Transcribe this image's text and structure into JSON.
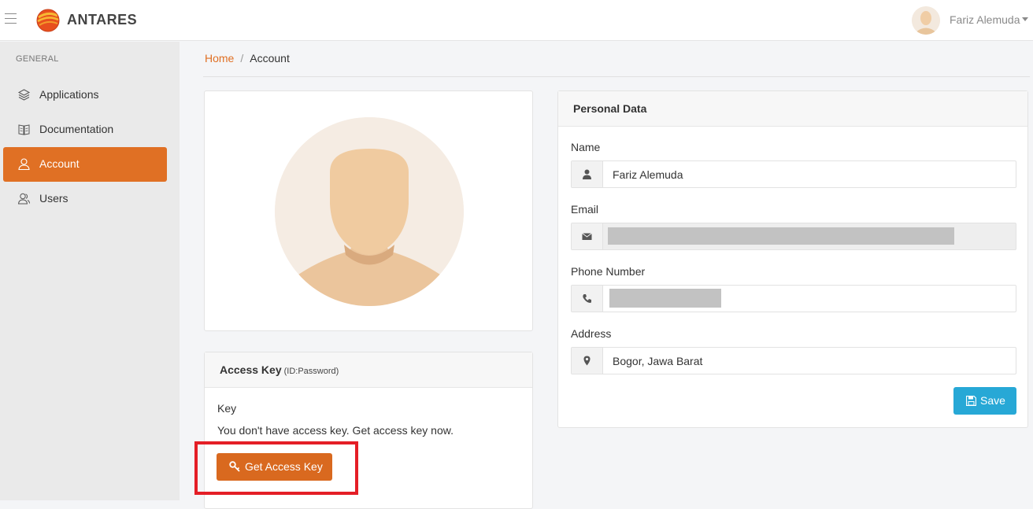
{
  "app": {
    "brand": "ANTARES"
  },
  "topbar": {
    "user_name": "Fariz Alemuda"
  },
  "sidebar": {
    "heading": "GENERAL",
    "items": [
      {
        "label": "Applications",
        "icon": "layers-icon",
        "active": false
      },
      {
        "label": "Documentation",
        "icon": "book-icon",
        "active": false
      },
      {
        "label": "Account",
        "icon": "user-icon",
        "active": true
      },
      {
        "label": "Users",
        "icon": "users-icon",
        "active": false
      }
    ]
  },
  "breadcrumb": {
    "home": "Home",
    "separator": "/",
    "current": "Account"
  },
  "access_key": {
    "title": "Access Key",
    "subtitle": "(ID:Password)",
    "key_label": "Key",
    "message": "You don't have access key. Get access key now.",
    "button_label": "Get Access Key"
  },
  "personal": {
    "title": "Personal Data",
    "name_label": "Name",
    "name_value": "Fariz Alemuda",
    "email_label": "Email",
    "email_value": "",
    "phone_label": "Phone Number",
    "phone_value": "",
    "address_label": "Address",
    "address_value": "Bogor, Jawa Barat",
    "save_label": "Save"
  },
  "colors": {
    "accent": "#e07024",
    "save_button": "#27a8d6",
    "highlight_box": "#e41e26"
  }
}
